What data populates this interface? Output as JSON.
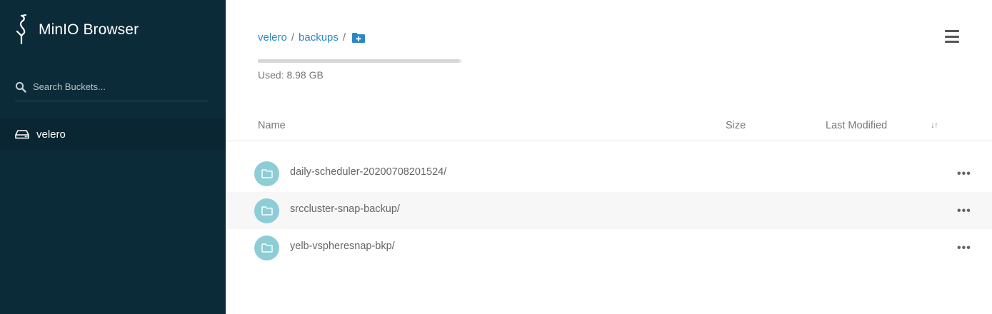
{
  "sidebar": {
    "app_title": "MinIO Browser",
    "logo_icon": "minio-heron-icon",
    "search": {
      "placeholder": "Search Buckets...",
      "icon": "search-icon"
    },
    "buckets": [
      {
        "label": "velero",
        "icon": "drive-icon"
      }
    ]
  },
  "main": {
    "breadcrumb": [
      {
        "label": "velero"
      },
      {
        "label": "backups"
      }
    ],
    "breadcrumb_separator": "/",
    "add_folder_icon": "folder-plus-icon",
    "usage": {
      "text": "Used: 8.98 GB",
      "fraction": 0.99
    },
    "menu_icon": "hamburger-icon",
    "columns": {
      "name": "Name",
      "size": "Size",
      "last_modified": "Last Modified",
      "sort_icon": "sort-icon",
      "sort_glyph": "↓↑"
    },
    "rows": [
      {
        "name": "daily-scheduler-20200708201524/",
        "icon": "folder-icon",
        "more": "•••"
      },
      {
        "name": "srccluster-snap-backup/",
        "icon": "folder-icon",
        "more": "•••"
      },
      {
        "name": "yelb-vspheresnap-bkp/",
        "icon": "folder-icon",
        "more": "•••"
      }
    ]
  },
  "colors": {
    "sidebar_bg": "#0c2b39",
    "link": "#2a88c7",
    "folder_circle": "#8dcdd6"
  }
}
